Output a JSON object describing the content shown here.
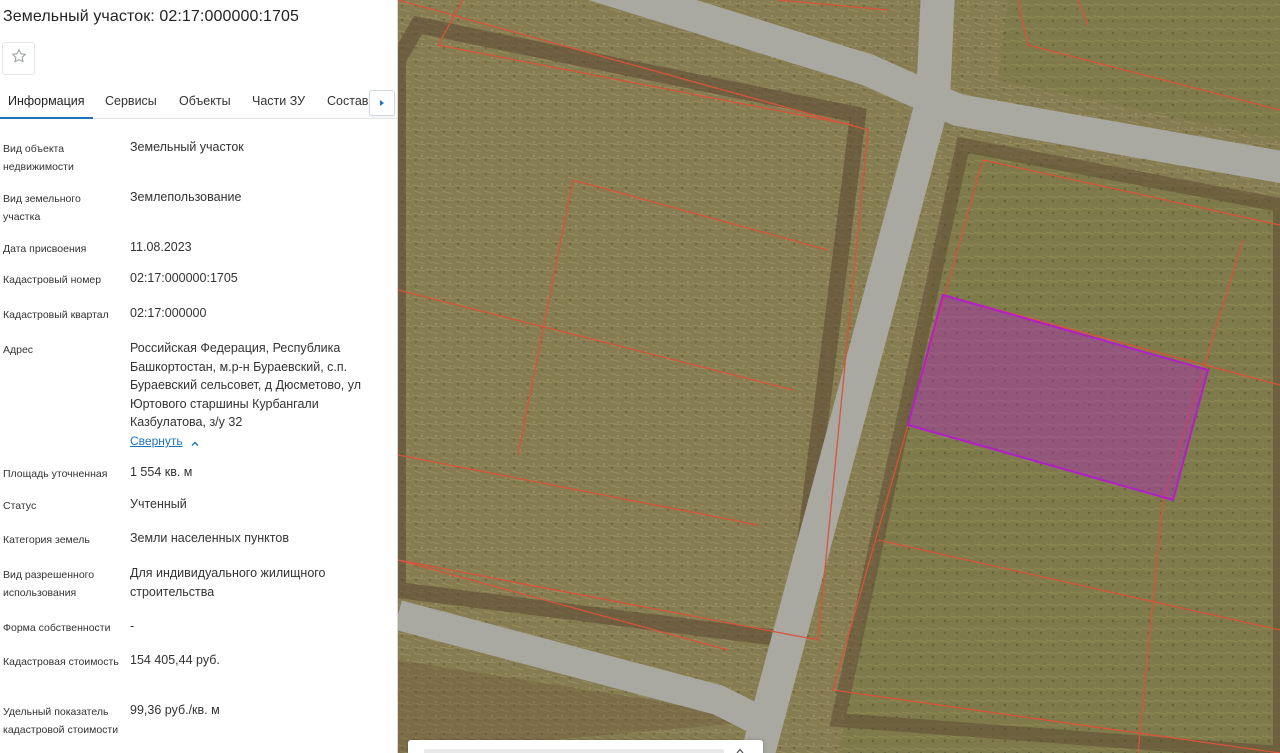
{
  "panel": {
    "title": "Земельный участок: 02:17:000000:1705",
    "favorite_icon": "star-outline-icon",
    "tabs": [
      {
        "label": "Информация",
        "active": true
      },
      {
        "label": "Сервисы",
        "active": false
      },
      {
        "label": "Объекты",
        "active": false
      },
      {
        "label": "Части ЗУ",
        "active": false
      },
      {
        "label": "Состав",
        "active": false
      }
    ],
    "tabs_more_icon": "arrow-right-icon",
    "rows": [
      {
        "label": "Вид объекта недвижимости",
        "value": "Земельный участок"
      },
      {
        "label": "Вид земельного участка",
        "value": "Землепользование"
      },
      {
        "label": "Дата присвоения",
        "value": "11.08.2023"
      },
      {
        "label": "Кадастровый номер",
        "value": "02:17:000000:1705"
      },
      {
        "label": "Кадастровый квартал",
        "value": "02:17:000000"
      },
      {
        "label": "Адрес",
        "value": "Российская Федерация, Республика Башкортостан, м.р-н Бураевский, с.п. Бураевский сельсовет, д Дюсметово, ул Юртового старшины Курбангали Казбулатова, з/у 32"
      },
      {
        "label": "Площадь уточненная",
        "value": "1 554 кв. м"
      },
      {
        "label": "Статус",
        "value": "Учтенный"
      },
      {
        "label": "Категория земель",
        "value": "Земли населенных пунктов"
      },
      {
        "label": "Вид разрешенного использования",
        "value": "Для индивидуального жилищного строительства"
      },
      {
        "label": "Форма собственности",
        "value": "-"
      },
      {
        "label": "Кадастровая стоимость",
        "value": "154 405,44 руб."
      },
      {
        "label": "Удельный показатель кадастровой стоимости",
        "value": "99,36 руб./кв. м"
      }
    ],
    "collapse_link": "Свернуть",
    "collapse_icon": "chevron-up-icon"
  },
  "map": {
    "parcel_color": "#b21ec8",
    "boundary_color": "#d9533a",
    "road_color": "#a9a9a2"
  }
}
